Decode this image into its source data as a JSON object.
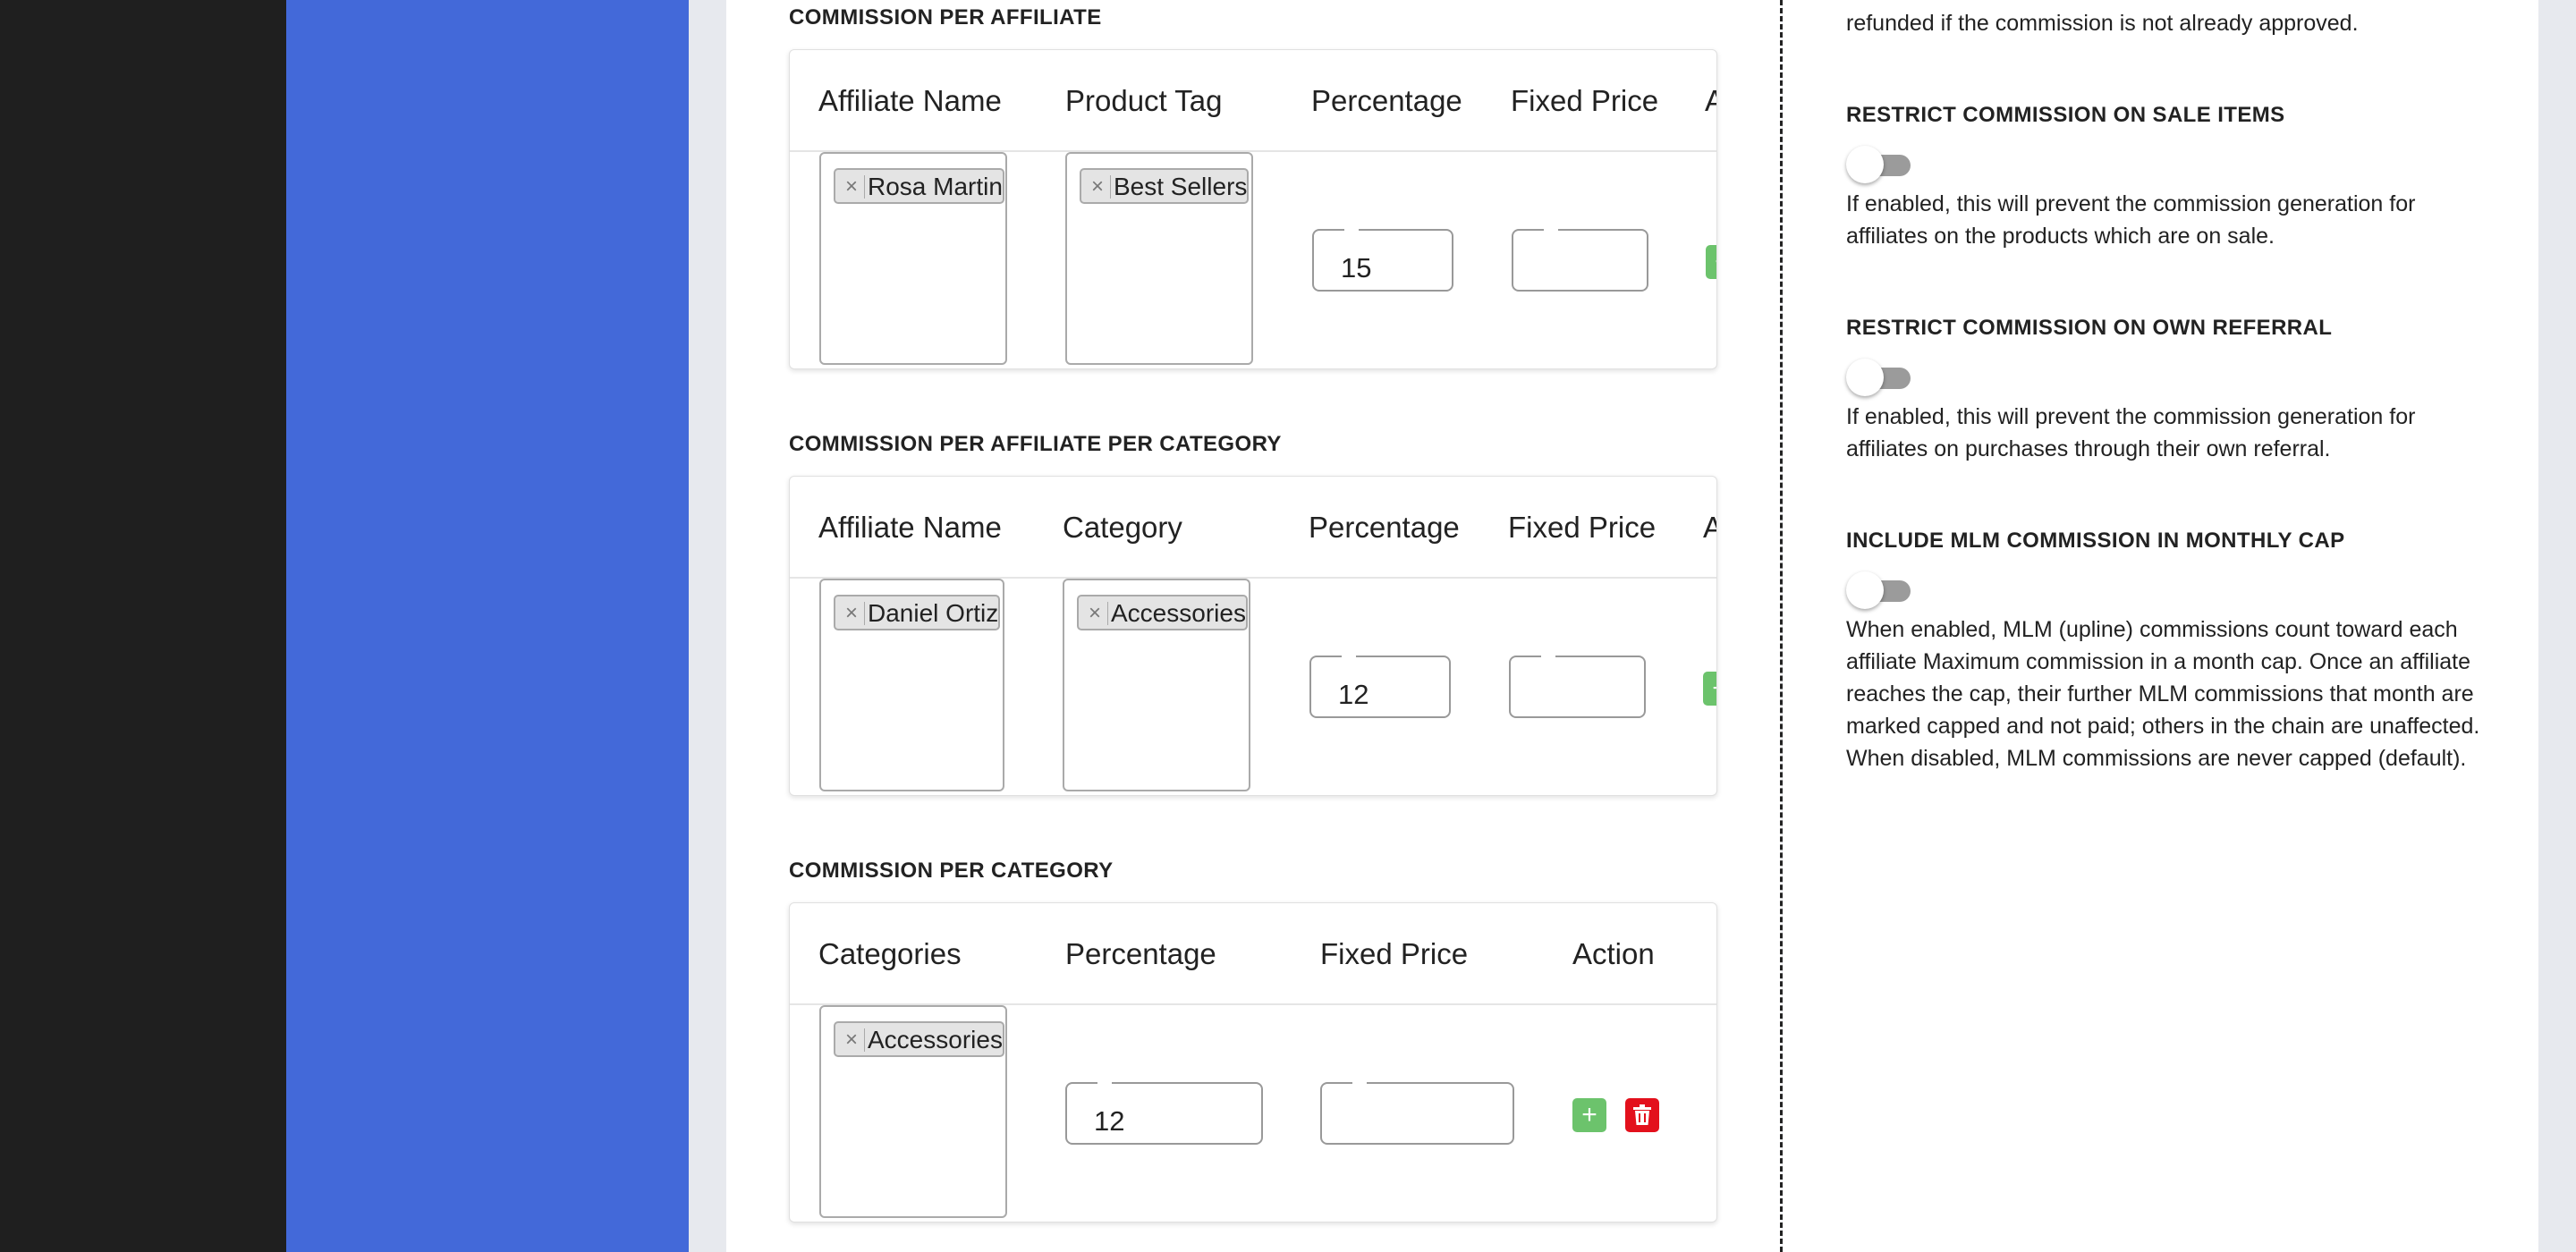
{
  "tables": {
    "per_affiliate": {
      "title": "COMMISSION PER AFFILIATE",
      "headers": [
        "Affiliate Name",
        "Product Tag",
        "Percentage",
        "Fixed Price",
        "A"
      ],
      "row": {
        "affiliate": "Rosa Martin",
        "tag": "Best Sellers",
        "percentage": "15",
        "fixed_price": ""
      }
    },
    "per_affiliate_category": {
      "title": "COMMISSION PER AFFILIATE PER CATEGORY",
      "headers": [
        "Affiliate Name",
        "Category",
        "Percentage",
        "Fixed Price",
        "A"
      ],
      "row": {
        "affiliate": "Daniel Ortiz",
        "category": "Accessories",
        "percentage": "12",
        "fixed_price": ""
      }
    },
    "per_category": {
      "title": "COMMISSION PER CATEGORY",
      "headers": [
        "Categories",
        "Percentage",
        "Fixed Price",
        "Action"
      ],
      "row": {
        "category": "Accessories",
        "percentage": "12",
        "fixed_price": ""
      }
    }
  },
  "settings": {
    "top_text": "refunded if the commission is not already approved.",
    "sale_items": {
      "title": "RESTRICT COMMISSION ON SALE ITEMS",
      "enabled": false,
      "desc_line1": "If enabled, this will prevent the commission generation for",
      "desc_line2": "affiliates on the products which are on sale."
    },
    "own_referral": {
      "title": "RESTRICT COMMISSION ON OWN REFERRAL",
      "enabled": false,
      "desc_line1": "If enabled, this will prevent the commission generation for",
      "desc_line2": "affiliates on purchases through their own referral."
    },
    "mlm_cap": {
      "title": "INCLUDE MLM COMMISSION IN MONTHLY CAP",
      "enabled": false,
      "desc_line1": "When enabled, MLM (upline) commissions count toward each",
      "desc_line2": "affiliate Maximum commission in a month cap. Once an affiliate",
      "desc_line3": "reaches the cap, their further MLM commissions that month are",
      "desc_line4": "marked capped and not paid; others in the chain are unaffected.",
      "desc_line5": "When disabled, MLM commissions are never capped (default)."
    }
  },
  "icons": {
    "remove_tag": "×",
    "add": "+",
    "delete": "trash-icon"
  },
  "colors": {
    "sidebar_dark": "#1f1f1f",
    "sidebar_blue": "#4369d9",
    "add_green": "#6cc36c",
    "delete_red": "#e3101c",
    "toggle_off": "#9b9b9b"
  }
}
